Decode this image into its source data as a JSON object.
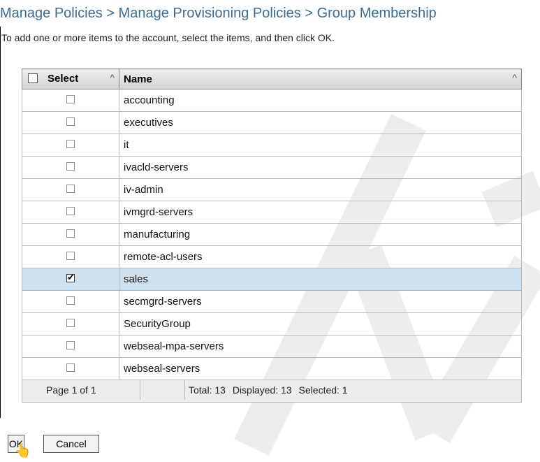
{
  "page": {
    "title": "Manage Policies > Manage Provisioning Policies > Group Membership",
    "instructions": "To add one or more items to the account, select the items, and then click OK."
  },
  "table": {
    "headers": {
      "select": "Select",
      "name": "Name"
    },
    "rows": [
      {
        "name": "accounting",
        "checked": false
      },
      {
        "name": "executives",
        "checked": false
      },
      {
        "name": "it",
        "checked": false
      },
      {
        "name": "ivacld-servers",
        "checked": false
      },
      {
        "name": "iv-admin",
        "checked": false
      },
      {
        "name": "ivmgrd-servers",
        "checked": false
      },
      {
        "name": "manufacturing",
        "checked": false
      },
      {
        "name": "remote-acl-users",
        "checked": false
      },
      {
        "name": "sales",
        "checked": true
      },
      {
        "name": "secmgrd-servers",
        "checked": false
      },
      {
        "name": "SecurityGroup",
        "checked": false
      },
      {
        "name": "webseal-mpa-servers",
        "checked": false
      },
      {
        "name": "webseal-servers",
        "checked": false
      }
    ],
    "footer": {
      "page": "Page 1 of 1",
      "total": "Total: 13",
      "displayed": "Displayed: 13",
      "selected": "Selected: 1"
    }
  },
  "buttons": {
    "ok": "OK",
    "cancel": "Cancel"
  },
  "icons": {
    "sort": "caret-up-icon",
    "cursor": "pointer-cursor-icon"
  },
  "colors": {
    "title": "#3a6c93",
    "selected_row": "#cfe0ef"
  }
}
